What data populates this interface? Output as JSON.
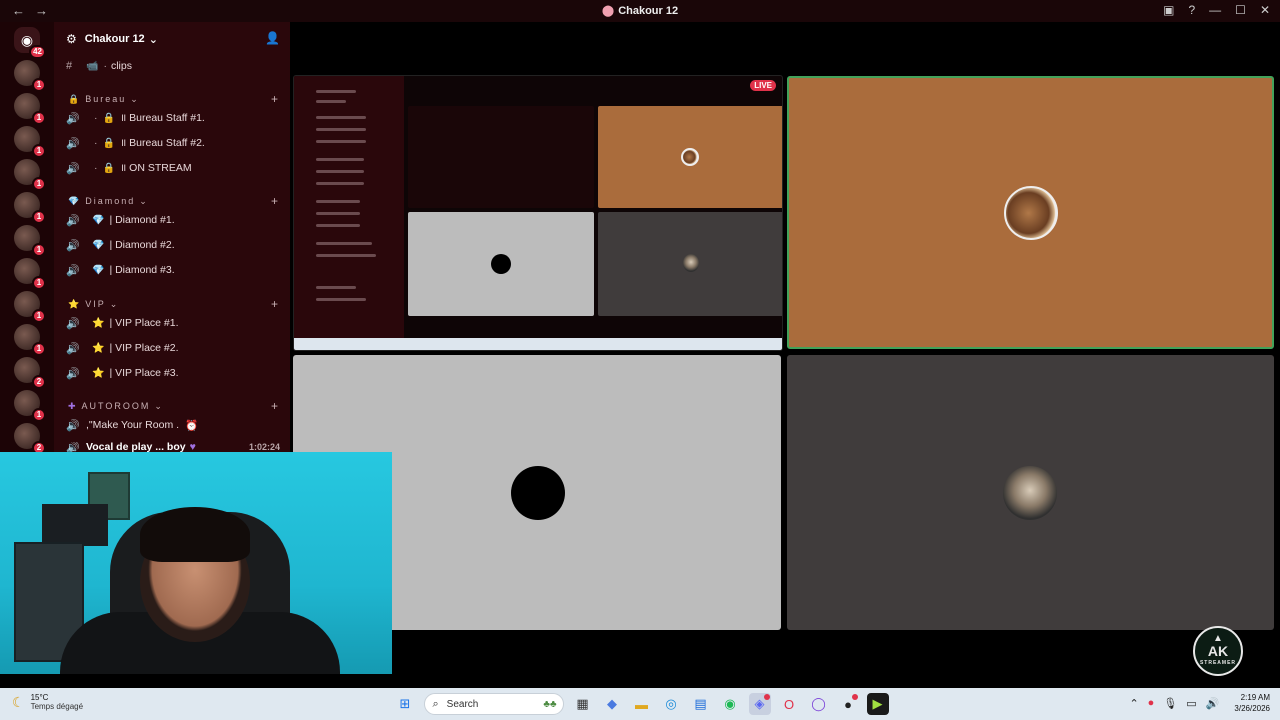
{
  "window": {
    "title": "Chakour 12",
    "back_icon": "arrow-left-icon",
    "forward_icon": "arrow-right-icon"
  },
  "servers": {
    "home_badge": "42",
    "items": [
      {
        "badge": "1"
      },
      {
        "badge": "1"
      },
      {
        "badge": "1"
      },
      {
        "badge": "1"
      },
      {
        "badge": "1"
      },
      {
        "badge": "1"
      },
      {
        "badge": "1"
      },
      {
        "badge": "1"
      },
      {
        "badge": "1"
      },
      {
        "badge": "2"
      },
      {
        "badge": "1"
      },
      {
        "badge": "2"
      },
      {
        "badge": "2"
      }
    ]
  },
  "guild": {
    "name": "Chakour 12",
    "channels": {
      "clips": "clips",
      "cat_bureau": "Bureau",
      "bureau1": "॥ Bureau Staff #1.",
      "bureau2": "॥ Bureau Staff #2.",
      "onstream": "॥ ON STREAM",
      "cat_diamond": "Diamond",
      "diamond1": "| Diamond #1.",
      "diamond2": "| Diamond #2.",
      "diamond3": "| Diamond #3.",
      "cat_vip": "VIP",
      "vip1": "| VIP Place #1.",
      "vip2": "| VIP Place #2.",
      "vip3": "| VIP Place #3.",
      "cat_autoroom": "AUTOROOM",
      "makeroom": ",\"Make Your Room .",
      "vocal": "Vocal de play ... boy",
      "vocal_time": "1:02:24"
    }
  },
  "stage": {
    "live_label": "LIVE"
  },
  "logo": {
    "text": "AK",
    "sub": "STREAMER"
  },
  "taskbar": {
    "weather_temp": "15°C",
    "weather_desc": "Temps dégagé",
    "search_placeholder": "Search",
    "time": "2:19 AM",
    "date": "3/26/2026"
  }
}
